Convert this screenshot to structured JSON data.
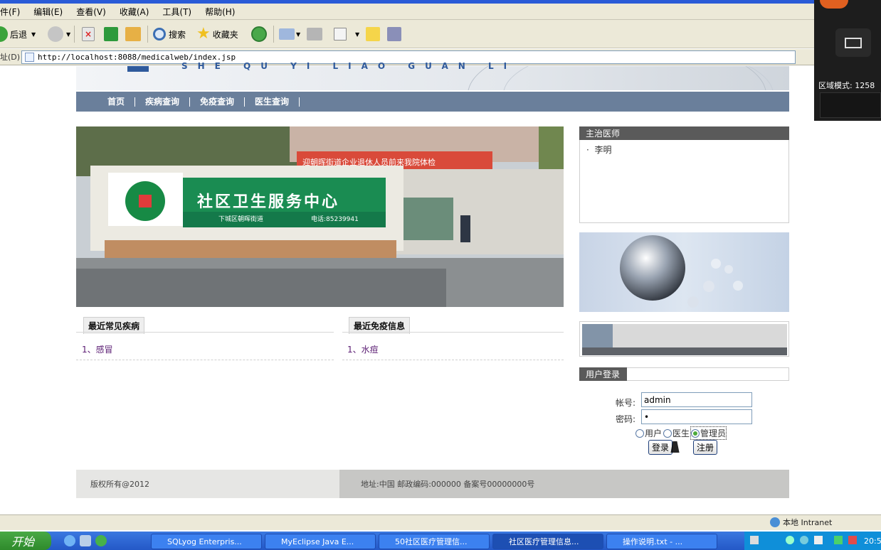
{
  "browser": {
    "menu": [
      "件(F)",
      "编辑(E)",
      "查看(V)",
      "收藏(A)",
      "工具(T)",
      "帮助(H)"
    ],
    "toolbar": {
      "back": "后退",
      "search": "搜索",
      "favorites": "收藏夹"
    },
    "address_label": "址(D)",
    "url": "http://localhost:8088/medicalweb/index.jsp"
  },
  "overlay": {
    "region_mode": "区域模式: 1258"
  },
  "site": {
    "banner_sub": "SHE QU YI LIAO GUAN LI",
    "nav": [
      "首页",
      "疾病查询",
      "免疫查询",
      "医生查询"
    ],
    "photo_sign": "社区卫生服务中心",
    "photo_sign_sub": "下城区朝晖街道",
    "photo_sign_tel": "电话:85239941",
    "photo_banner": "迎朝晖街道企业退休人员前来我院体检",
    "doctor_panel": {
      "title": "主治医师",
      "items": [
        "李明"
      ]
    },
    "sections": {
      "common_disease": {
        "title": "最近常见疾病",
        "items": [
          "1、感冒"
        ]
      },
      "immunity": {
        "title": "最近免疫信息",
        "items": [
          "1、水痘"
        ]
      }
    },
    "login": {
      "title": "用户登录",
      "account_label": "帐号:",
      "password_label": "密码:",
      "account_value": "admin",
      "password_value": "•",
      "roles": [
        "用户",
        "医生",
        "管理员"
      ],
      "selected_role": "管理员",
      "login_button": "登录",
      "register_button": "注册"
    },
    "footer": {
      "copyright": "版权所有@2012",
      "address": "地址:中国 邮政编码:000000    备案号00000000号"
    }
  },
  "statusbar": {
    "zone": "本地 Intranet"
  },
  "taskbar": {
    "start": "开始",
    "tasks": [
      "SQLyog Enterpris...",
      "MyEclipse Java E...",
      "50社区医疗管理信...",
      "社区医疗管理信息...",
      "操作说明.txt - ..."
    ],
    "clock": "20:5"
  },
  "colors": {
    "nav_bg": "#6a7f9b",
    "panel_head": "#5a5a5a",
    "link": "#5b1d73"
  }
}
